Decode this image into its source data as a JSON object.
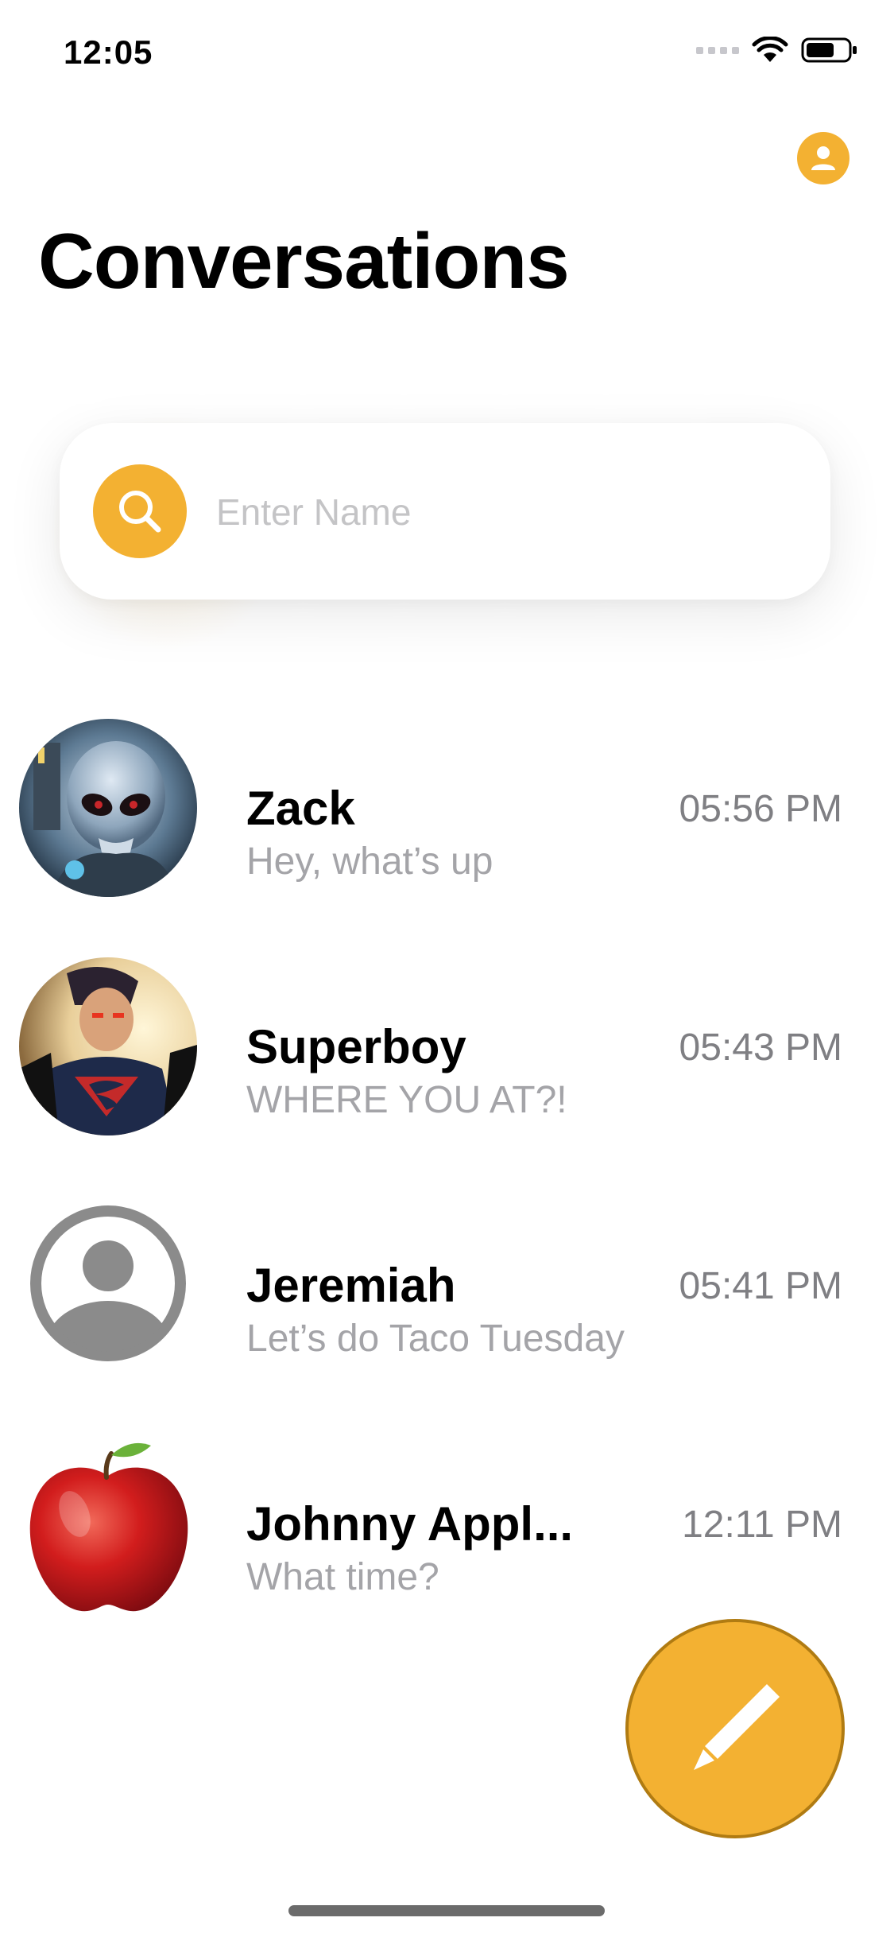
{
  "status_bar": {
    "time": "12:05"
  },
  "header": {
    "title": "Conversations",
    "profile_icon": "person-circle-icon"
  },
  "search": {
    "placeholder": "Enter Name",
    "value": "",
    "icon": "search-icon"
  },
  "conversations": [
    {
      "name": "Zack",
      "preview": "Hey, what’s up",
      "time": "05:56 PM",
      "avatar": "alien-character-photo"
    },
    {
      "name": "Superboy",
      "preview": "WHERE YOU AT?!",
      "time": "05:43 PM",
      "avatar": "superboy-character-photo"
    },
    {
      "name": "Jeremiah",
      "preview": "Let’s do Taco Tuesday",
      "time": "05:41 PM",
      "avatar": "default-person-icon"
    },
    {
      "name": "Johnny Appl...",
      "preview": "What time?",
      "time": "12:11 PM",
      "avatar": "red-apple-photo"
    }
  ],
  "compose": {
    "icon": "pencil-icon"
  },
  "colors": {
    "accent": "#f3b132",
    "accent_border": "#b07b12",
    "preview_text": "#a4a4a8",
    "time_text": "#7f7f83"
  }
}
